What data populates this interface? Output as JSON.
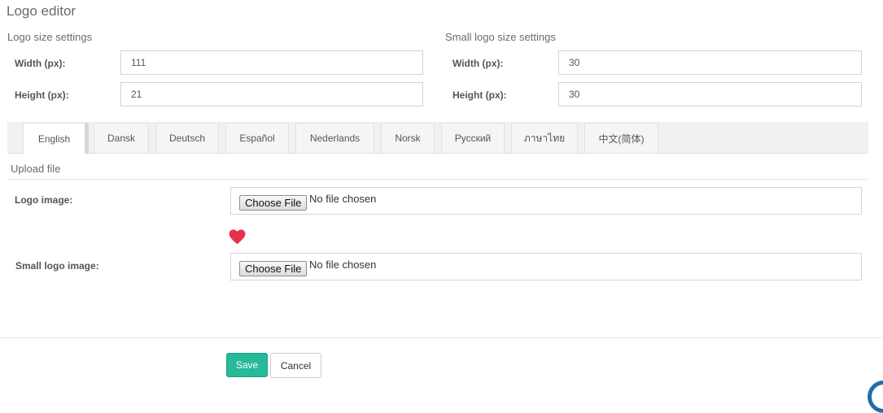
{
  "page": {
    "title": "Logo editor"
  },
  "logo_size": {
    "title": "Logo size settings",
    "width_label": "Width (px):",
    "width_value": "111",
    "height_label": "Height (px):",
    "height_value": "21"
  },
  "small_logo_size": {
    "title": "Small logo size settings",
    "width_label": "Width (px):",
    "width_value": "30",
    "height_label": "Height (px):",
    "height_value": "30"
  },
  "tabs": [
    {
      "label": "English",
      "active": true
    },
    {
      "label": "Dansk",
      "active": false
    },
    {
      "label": "Deutsch",
      "active": false
    },
    {
      "label": "Español",
      "active": false
    },
    {
      "label": "Nederlands",
      "active": false
    },
    {
      "label": "Norsk",
      "active": false
    },
    {
      "label": "Русский",
      "active": false
    },
    {
      "label": "ภาษาไทย",
      "active": false
    },
    {
      "label": "中文(简体)",
      "active": false
    }
  ],
  "upload": {
    "section_title": "Upload file",
    "logo_label": "Logo image:",
    "small_logo_label": "Small logo image:",
    "choose_button": "Choose File",
    "no_file_text": "No file chosen",
    "divider_icon": "heart-icon"
  },
  "actions": {
    "save_label": "Save",
    "cancel_label": "Cancel"
  },
  "colors": {
    "save_button": "#26b99a",
    "heart": "#e8314f",
    "corner_widget": "#1f6fa8"
  }
}
